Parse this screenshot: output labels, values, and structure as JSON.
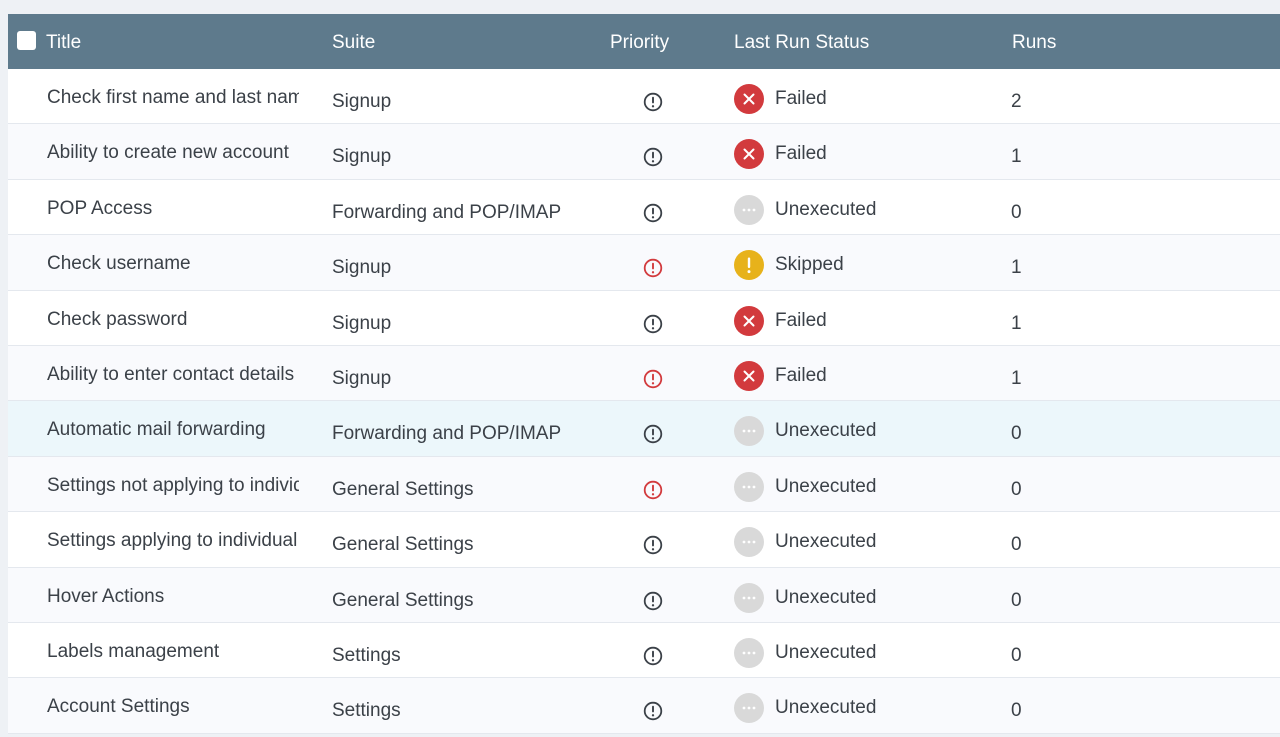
{
  "header": {
    "title": "Title",
    "suite": "Suite",
    "priority": "Priority",
    "last_run_status": "Last Run Status",
    "runs": "Runs"
  },
  "colors": {
    "header_bg": "#5e7a8c",
    "failed": "#d23a3d",
    "skipped": "#e7b21b",
    "unexecuted": "#d9d9d9",
    "priority_normal": "#3b4148",
    "priority_high": "#d23a3d"
  },
  "rows": [
    {
      "title": "Check first name and last name",
      "suite": "Signup",
      "priority": "normal",
      "status": "Failed",
      "status_icon": "failed-icon",
      "runs": "2"
    },
    {
      "title": "Ability to create new account",
      "suite": "Signup",
      "priority": "normal",
      "status": "Failed",
      "status_icon": "failed-icon",
      "runs": "1"
    },
    {
      "title": "POP Access",
      "suite": "Forwarding and POP/IMAP",
      "priority": "normal",
      "status": "Unexecuted",
      "status_icon": "unexecuted-icon",
      "runs": "0"
    },
    {
      "title": "Check username",
      "suite": "Signup",
      "priority": "high",
      "status": "Skipped",
      "status_icon": "skipped-icon",
      "runs": "1"
    },
    {
      "title": "Check password",
      "suite": "Signup",
      "priority": "normal",
      "status": "Failed",
      "status_icon": "failed-icon",
      "runs": "1"
    },
    {
      "title": "Ability to enter contact details",
      "suite": "Signup",
      "priority": "high",
      "status": "Failed",
      "status_icon": "failed-icon",
      "runs": "1"
    },
    {
      "title": "Automatic mail forwarding",
      "suite": "Forwarding and POP/IMAP",
      "priority": "normal",
      "status": "Unexecuted",
      "status_icon": "unexecuted-icon",
      "runs": "0"
    },
    {
      "title": "Settings not applying to individual",
      "suite": "General Settings",
      "priority": "high",
      "status": "Unexecuted",
      "status_icon": "unexecuted-icon",
      "runs": "0"
    },
    {
      "title": "Settings applying to individual",
      "suite": "General Settings",
      "priority": "normal",
      "status": "Unexecuted",
      "status_icon": "unexecuted-icon",
      "runs": "0"
    },
    {
      "title": "Hover Actions",
      "suite": "General Settings",
      "priority": "normal",
      "status": "Unexecuted",
      "status_icon": "unexecuted-icon",
      "runs": "0"
    },
    {
      "title": "Labels management",
      "suite": "Settings",
      "priority": "normal",
      "status": "Unexecuted",
      "status_icon": "unexecuted-icon",
      "runs": "0"
    },
    {
      "title": "Account Settings",
      "suite": "Settings",
      "priority": "normal",
      "status": "Unexecuted",
      "status_icon": "unexecuted-icon",
      "runs": "0"
    }
  ]
}
